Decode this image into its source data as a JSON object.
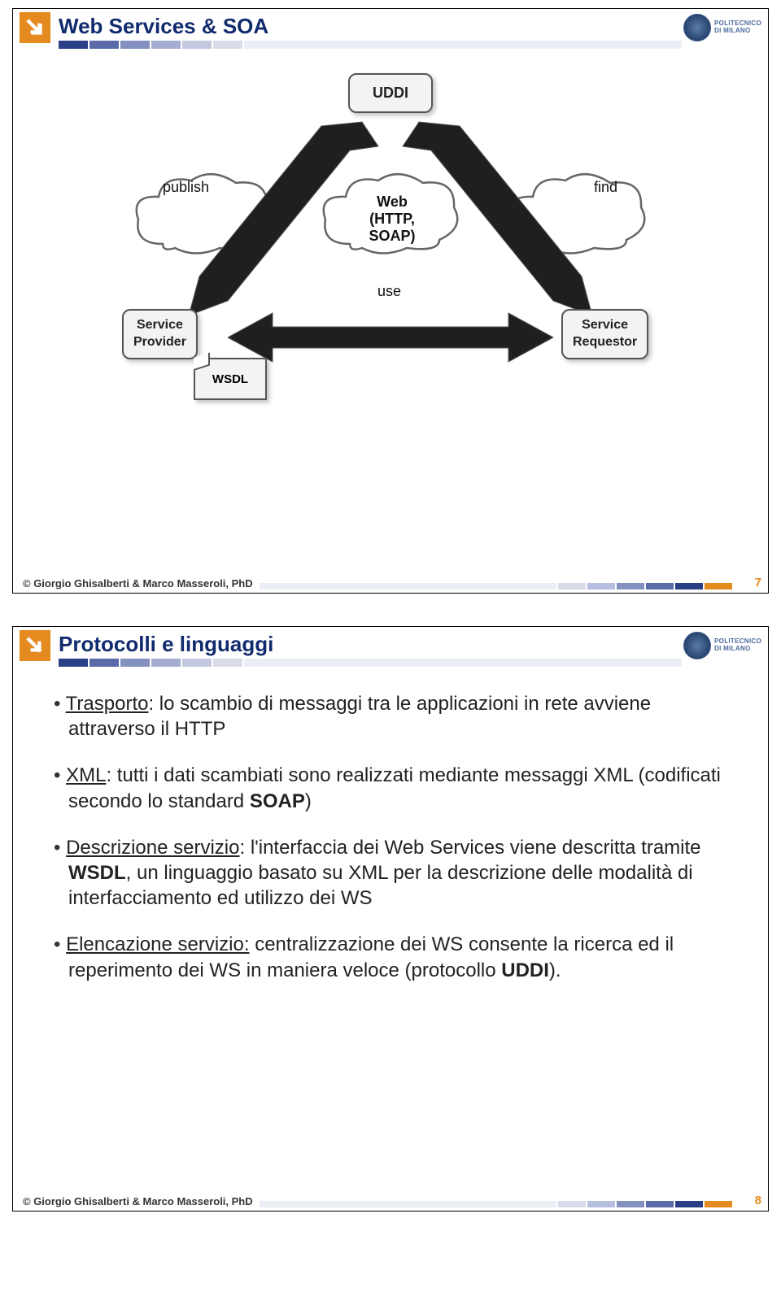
{
  "logo": {
    "line1": "POLITECNICO",
    "line2": "DI MILANO"
  },
  "footer": {
    "copyright": "© Giorgio Ghisalberti & Marco Masseroli, PhD"
  },
  "slide1": {
    "title": "Web Services & SOA",
    "page": "7",
    "diagram": {
      "uddi": "UDDI",
      "web_label_line1": "Web",
      "web_label_line2": "(HTTP, SOAP)",
      "provider_line1": "Service",
      "provider_line2": "Provider",
      "requestor_line1": "Service",
      "requestor_line2": "Requestor",
      "wsdl": "WSDL",
      "publish": "publish",
      "find": "find",
      "use": "use"
    }
  },
  "slide2": {
    "title": "Protocolli e linguaggi",
    "page": "8",
    "bullets": {
      "b1_head": "Trasporto",
      "b1_rest": ": lo scambio di messaggi tra le applicazioni in rete avviene attraverso il HTTP",
      "b2_head": "XML",
      "b2_mid": ": tutti i dati scambiati sono realizzati mediante messaggi XML (codificati secondo lo standard ",
      "b2_bold": "SOAP",
      "b2_end": ")",
      "b3_head": "Descrizione servizio",
      "b3_mid": ": l'interfaccia dei Web Services viene descritta tramite ",
      "b3_bold": "WSDL",
      "b3_rest": ", un linguaggio basato su XML per la descrizione delle modalità di interfacciamento ed utilizzo dei WS",
      "b4_head": "Elencazione servizio:",
      "b4_mid": " centralizzazione dei WS consente la ricerca ed il reperimento dei WS in maniera veloce (protocollo ",
      "b4_bold": "UDDI",
      "b4_end": ")."
    }
  },
  "stripe_colors": {
    "header": [
      "#2b3f86",
      "#5b6baa",
      "#8490bf",
      "#a5aed0",
      "#c3c8de",
      "#d8dbe9",
      "#e8eaf2"
    ],
    "footer": [
      "#e8eaf2",
      "#b6bfe0",
      "#7a89c2",
      "#4a5ea8",
      "#2b3f86",
      "#E58A1F"
    ]
  }
}
